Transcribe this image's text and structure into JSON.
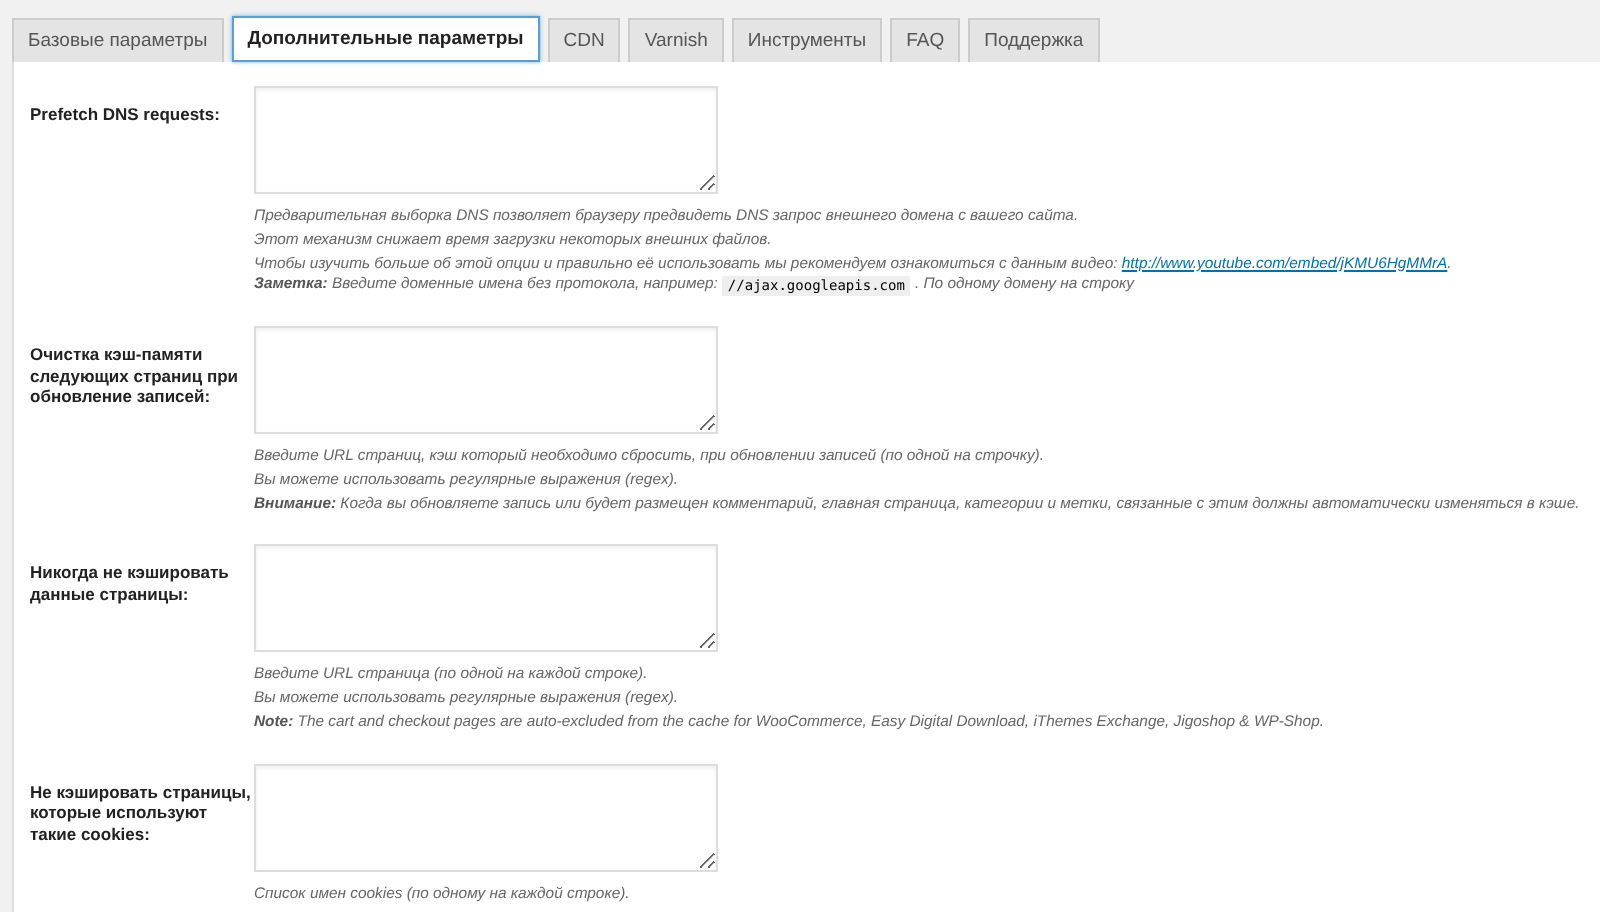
{
  "tabs": [
    {
      "label": "Базовые параметры",
      "selected": false
    },
    {
      "label": "Дополнительные параметры",
      "selected": true
    },
    {
      "label": "CDN",
      "selected": false
    },
    {
      "label": "Varnish",
      "selected": false
    },
    {
      "label": "Инструменты",
      "selected": false
    },
    {
      "label": "FAQ",
      "selected": false
    },
    {
      "label": "Поддержка",
      "selected": false
    }
  ],
  "fields": [
    {
      "label": "Prefetch DNS requests:",
      "description": [
        {
          "kind": "text",
          "text": "Предварительная выборка DNS позволяет браузеру предвидеть DNS запрос внешнего домена с вашего сайта."
        },
        {
          "kind": "text",
          "text": "Этот механизм снижает время загрузки некоторых внешних файлов."
        },
        {
          "kind": "link",
          "text": "Чтобы изучить больше об этой опции и правильно её использовать мы рекомендуем ознакомиться с данным видео:",
          "link": "http://www.youtube.com/embed/jKMU6HgMMrA",
          "after": "."
        },
        {
          "kind": "code",
          "before": "**Заметка:** Введите доменные имена без протокола, например:",
          "code": "//ajax.googleapis.com",
          "after": ". По одному домену на строку"
        }
      ]
    },
    {
      "label": "Очистка кэш-памяти следующих страниц при обновление записей:",
      "description": [
        {
          "kind": "text",
          "text": "Введите URL страниц, кэш который необходимо сбросить, при обновлении записей (по одной на строчку)."
        },
        {
          "kind": "text",
          "text": "Вы можете использовать регулярные выражения (regex)."
        },
        {
          "kind": "text",
          "text": "**Внимание:** Когда вы обновляете запись или будет размещен комментарий, главная страница, категории и метки, связанные с этим должны автоматически изменяться в кэше."
        }
      ]
    },
    {
      "label": "Никогда не кэшировать данные страницы:",
      "description": [
        {
          "kind": "text",
          "text": "Введите URL страница (по одной на каждой строке)."
        },
        {
          "kind": "text",
          "text": "Вы можете использовать регулярные выражения (regex)."
        },
        {
          "kind": "text",
          "text": "**Note:** The cart and checkout pages are auto-excluded from the cache for WooCommerce, Easy Digital Download, iThemes Exchange, Jigoshop & WP-Shop."
        }
      ]
    },
    {
      "label": "Не кэшировать страницы, которые используют такие cookies:",
      "description": [
        {
          "kind": "text",
          "text": "Список имен cookies (по одному на каждой строке)."
        }
      ]
    }
  ]
}
